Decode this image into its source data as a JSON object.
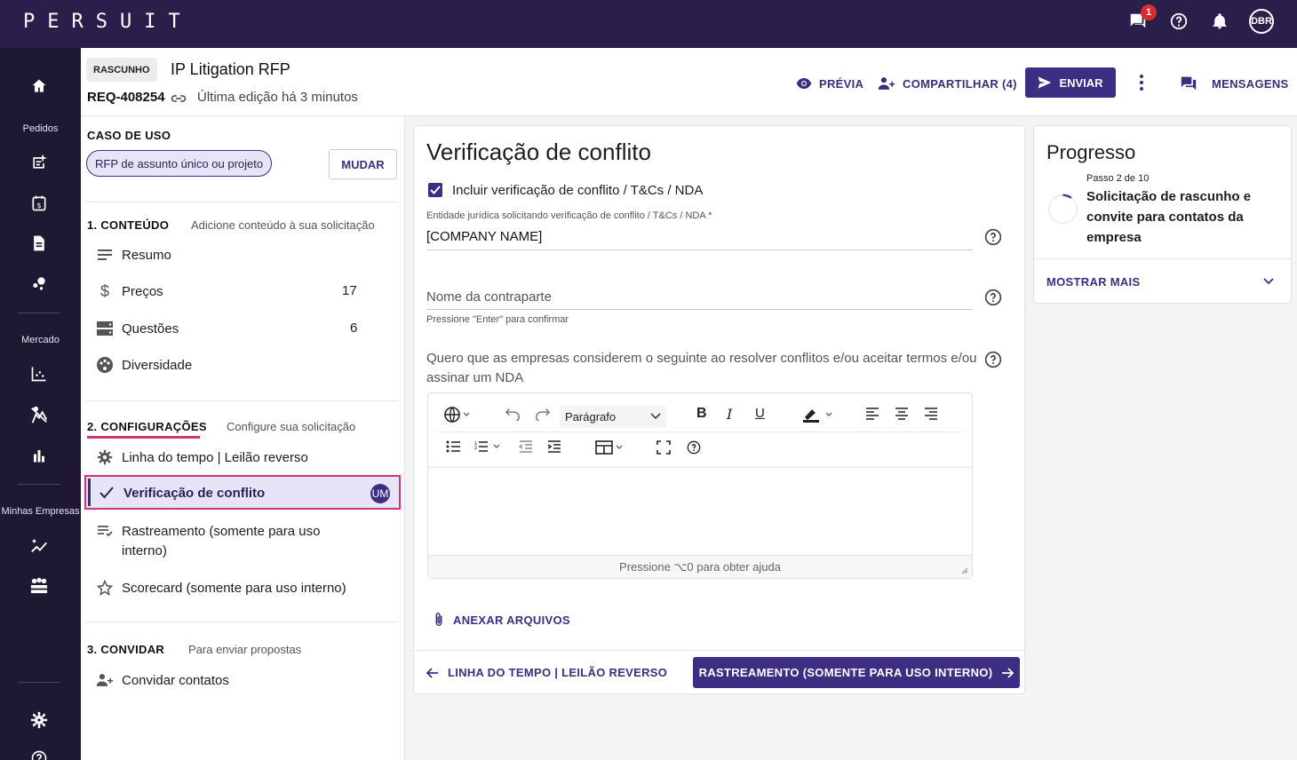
{
  "brand": {
    "logo": "PERSUIT"
  },
  "topbar": {
    "notification_count": "1",
    "user_initials": "DBR"
  },
  "rail": {
    "sections": [
      "Pedidos",
      "Mercado",
      "Minhas Empresas"
    ],
    "icons": [
      "home-icon",
      "new-request-icon",
      "billing-icon",
      "document-icon",
      "analytics-dots-icon",
      "chart-icon",
      "person-chart-icon",
      "bar-chart-icon",
      "sparkle-chart-icon",
      "team-icon",
      "settings-icon",
      "help-icon"
    ]
  },
  "header": {
    "status": "RASCUNHO",
    "title": "IP Litigation RFP",
    "request_id": "REQ-408254",
    "last_edited": "Última edição há 3 minutos",
    "preview_label": "PRÉVIA",
    "share_label": "COMPARTILHAR (4)",
    "send_label": "ENVIAR",
    "messages_label": "MENSAGENS"
  },
  "leftnav": {
    "use_case": {
      "label": "CASO DE USO",
      "value": "RFP de assunto único ou projeto",
      "change_label": "MUDAR"
    },
    "content": {
      "label": "1. CONTEÚDO",
      "sub": "Adicione conteúdo à sua solicitação",
      "items": [
        {
          "label": "Resumo",
          "count": ""
        },
        {
          "label": "Preços",
          "count": "17"
        },
        {
          "label": "Questões",
          "count": "6"
        },
        {
          "label": "Diversidade",
          "count": ""
        }
      ]
    },
    "settings": {
      "label": "2. CONFIGURAÇÕES",
      "sub": "Configure sua solicitação",
      "items": [
        {
          "label": "Linha do tempo | Leilão reverso"
        },
        {
          "label": "Verificação de conflito",
          "badge": "UM"
        },
        {
          "label": "Rastreamento (somente para uso interno)"
        },
        {
          "label": "Scorecard (somente para uso interno)"
        }
      ]
    },
    "invite": {
      "label": "3. CONVIDAR",
      "sub": "Para enviar propostas",
      "items": [
        {
          "label": "Convidar contatos"
        }
      ]
    }
  },
  "main": {
    "title": "Verificação de conflito",
    "checkbox_label": "Incluir verificação de conflito / T&Cs / NDA",
    "entity_label": "Entidade jurídica solicitando verificação de conflito / T&Cs / NDA *",
    "entity_value": "[COMPANY NAME]",
    "counterparty_placeholder": "Nome da contraparte",
    "counterparty_hint": "Pressione \"Enter\" para confirmar",
    "question": "Quero que as empresas considerem o seguinte ao resolver conflitos e/ou aceitar termos e/ou assinar um NDA",
    "editor": {
      "paragraph_select": "Parágrafo",
      "help_text": "Pressione ⌥0 para obter ajuda"
    },
    "attach_label": "ANEXAR ARQUIVOS",
    "prev_label": "LINHA DO TEMPO | LEILÃO REVERSO",
    "next_label": "RASTREAMENTO (SOMENTE PARA USO INTERNO)"
  },
  "progress": {
    "title": "Progresso",
    "step": "Passo 2 de 10",
    "description": "Solicitação de rascunho e convite para contatos da empresa",
    "show_more": "MOSTRAR MAIS"
  },
  "colors": {
    "primary": "#3d2d83",
    "topbar": "#2a1f4a",
    "rail": "#1e1833",
    "accent_pink": "#d0357a",
    "selected_bg": "#e8e4f8"
  }
}
